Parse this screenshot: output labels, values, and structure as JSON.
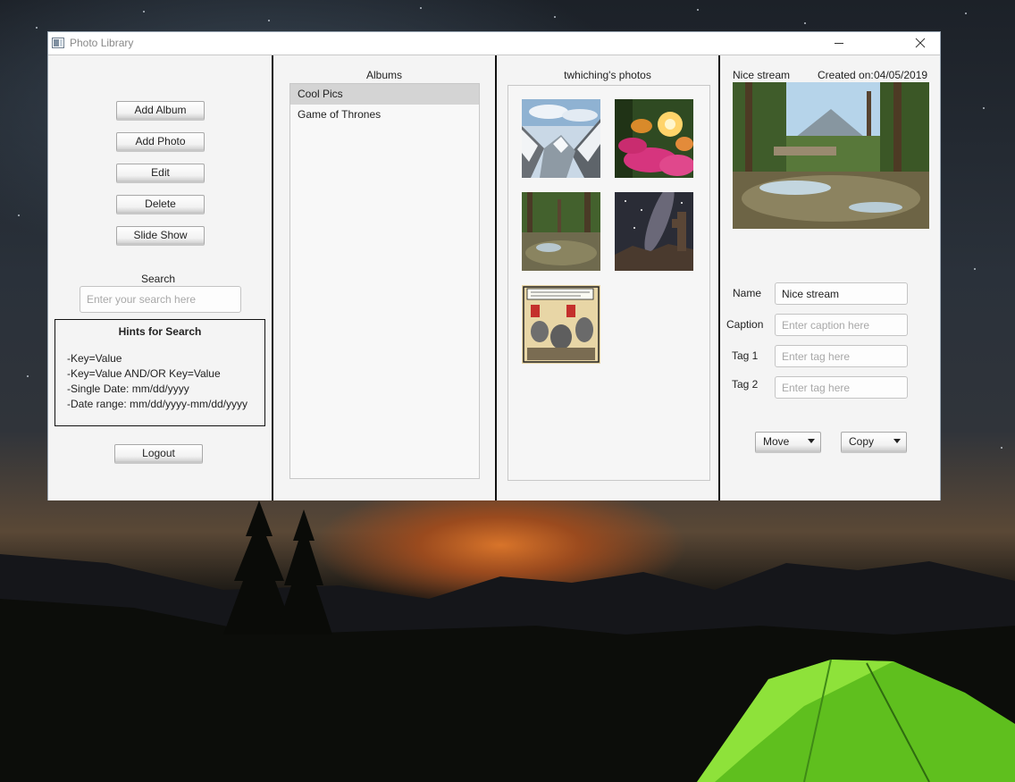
{
  "window": {
    "title": "Photo Library",
    "icons": {
      "app": "app-window-icon",
      "minimize": "minimize-icon",
      "close": "close-icon"
    }
  },
  "left": {
    "buttons": {
      "add_album": "Add Album",
      "add_photo": "Add Photo",
      "edit": "Edit",
      "delete": "Delete",
      "slide_show": "Slide Show",
      "logout": "Logout"
    },
    "search": {
      "label": "Search",
      "placeholder": "Enter your search here"
    },
    "hints": {
      "title": "Hints for Search",
      "lines": [
        "-Key=Value",
        "-Key=Value AND/OR Key=Value",
        "-Single Date: mm/dd/yyyy",
        "-Date range: mm/dd/yyyy-mm/dd/yyyy"
      ]
    }
  },
  "albums": {
    "header": "Albums",
    "items": [
      "Cool Pics",
      "Game of Thrones"
    ],
    "selected": "Cool Pics"
  },
  "photos": {
    "header": "twhiching's photos",
    "thumbnails": [
      "snowy-mountain-valley",
      "pink-flowers-sunset",
      "forest-stream",
      "night-sky-rocks",
      "comic-strip"
    ]
  },
  "detail": {
    "name_display": "Nice stream",
    "created_label": "Created on:",
    "created_date": "04/05/2019",
    "fields": {
      "name_label": "Name",
      "name_value": "Nice stream",
      "caption_label": "Caption",
      "caption_placeholder": "Enter caption here",
      "tag1_label": "Tag 1",
      "tag1_placeholder": "Enter tag here",
      "tag2_label": "Tag 2",
      "tag2_placeholder": "Enter tag here"
    },
    "actions": {
      "move": "Move",
      "copy": "Copy"
    }
  },
  "colors": {
    "panel_bg": "#f4f4f4",
    "selection": "#d4d4d4",
    "divider": "#111111"
  }
}
